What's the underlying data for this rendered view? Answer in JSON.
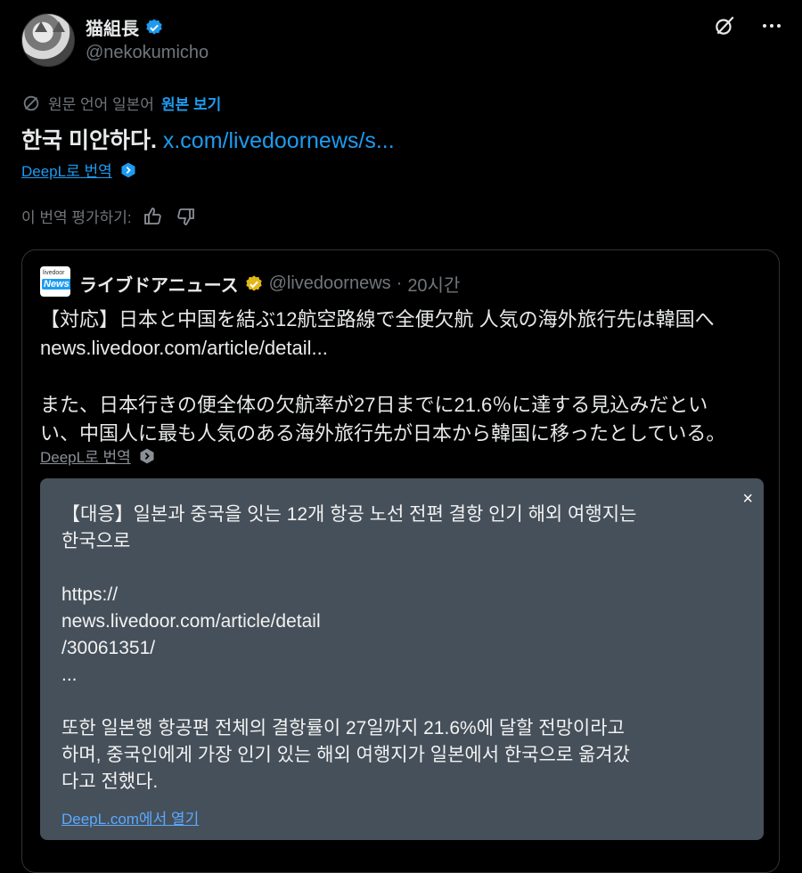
{
  "author": {
    "name": "猫組長",
    "handle": "@nekokumicho"
  },
  "original_language": {
    "label": "원문 언어 일본어",
    "link": "원본 보기"
  },
  "post": {
    "text": "한국 미안하다.",
    "link": "x.com/livedoornews/s..."
  },
  "deepl_translate": "DeepL로 번역",
  "rate": {
    "label": "이 번역 평가하기:"
  },
  "quote": {
    "name": "ライブドアニュース",
    "handle": "@livedoornews",
    "separator": "·",
    "time": "20시간",
    "logo_top": "livedoor",
    "logo_bottom": "News",
    "body": "【対応】日本と中国を結ぶ12航空路線で全便欠航 人気の海外旅行先は韓国へ\nnews.livedoor.com/article/detail...\n\nまた、日本行きの便全体の欠航率が27日までに21.6％に達する見込みだとい\nい、中国人に最も人気のある海外旅行先が日本から韓国に移ったとしている。",
    "deepl_translate": "DeepL로 번역"
  },
  "translation": {
    "text": "【대응】일본과 중국을 잇는 12개 항공 노선 전편 결항 인기 해외 여행지는\n한국으로\n\nhttps://\nnews.livedoor.com/article/detail\n/30061351/\n...\n\n또한 일본행 항공편 전체의 결항률이 27일까지 21.6%에 달할 전망이라고\n하며, 중국인에게 가장 인기 있는 해외 여행지가 일본에서 한국으로 옮겨갔\n다고 전했다.",
    "close": "×",
    "open_link": "DeepL.com에서 열기"
  },
  "colors": {
    "accent": "#1d9bf0",
    "verified_blue": "#1d9bf0",
    "verified_gold": "#e2b719",
    "background": "#000000",
    "translation_panel": "#46505a"
  },
  "icons": [
    "grok-icon",
    "more-icon",
    "translate-icon",
    "thumbs-up-icon",
    "thumbs-down-icon",
    "verified-badge-icon",
    "deepl-icon",
    "close-icon"
  ]
}
